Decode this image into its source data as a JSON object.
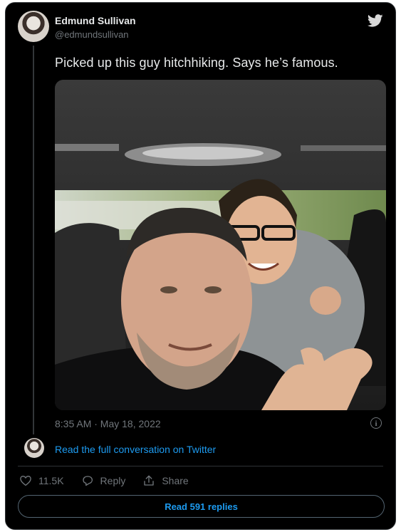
{
  "author": {
    "name": "Edmund Sullivan",
    "handle": "@edmundsullivan"
  },
  "tweet": {
    "text": "Picked up this guy hitchhiking. Says he’s famous.",
    "timestamp": "8:35 AM · May 18, 2022"
  },
  "conversation_link": "Read the full conversation on Twitter",
  "actions": {
    "likes": "11.5K",
    "reply": "Reply",
    "share": "Share"
  },
  "read_replies": "Read 591 replies",
  "colors": {
    "background": "#000000",
    "text": "#e7e9ea",
    "muted": "#71767b",
    "accent": "#1d9bf0",
    "border": "#2f3336"
  },
  "icons": [
    "twitter-bird-icon",
    "info-icon",
    "heart-icon",
    "reply-icon",
    "share-icon"
  ]
}
